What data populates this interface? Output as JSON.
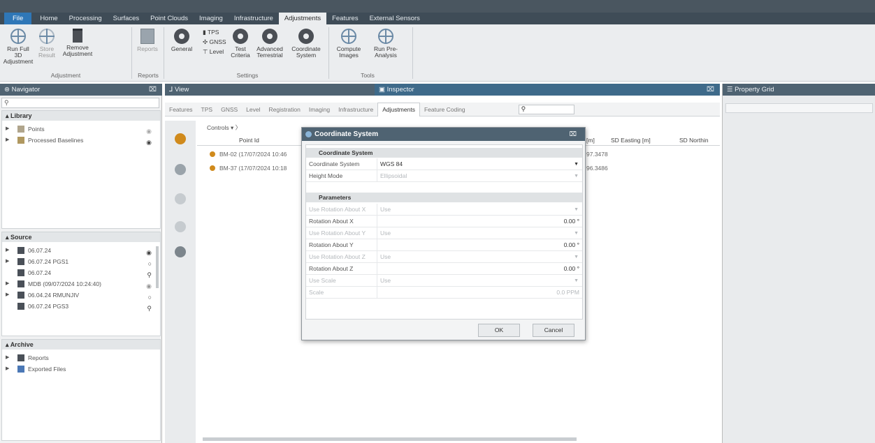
{
  "menu": {
    "items": [
      "File",
      "Home",
      "Processing",
      "Surfaces",
      "Point Clouds",
      "Imaging",
      "Infrastructure",
      "Adjustments",
      "Features",
      "External Sensors"
    ],
    "active": "Adjustments"
  },
  "ribbon": {
    "run_full": "Run Full 3D Adjustment",
    "store_result": "Store Result",
    "remove_adjustment": "Remove Adjustment",
    "reports": "Reports",
    "general": "General",
    "tps": "TPS",
    "gnss": "GNSS",
    "level": "Level",
    "test_criteria": "Test Criteria",
    "advanced_terrestrial": "Advanced Terrestrial",
    "coordinate_system": "Coordinate System",
    "compute_images": "Compute Images",
    "run_pre_analysis": "Run Pre-Analysis",
    "groups": {
      "adjustment": "Adjustment",
      "reports": "Reports",
      "settings": "Settings",
      "tools": "Tools"
    }
  },
  "navigator": {
    "title": "Navigator",
    "search_placeholder": "",
    "library": {
      "title": "Library",
      "items": [
        "Points",
        "Processed Baselines"
      ]
    },
    "source": {
      "title": "Source",
      "items": [
        "06.07.24",
        "06.07.24 PGS1",
        "06.07.24",
        "MDB (09/07/2024 10:24:40)",
        "06.04.24 RMUNJIV",
        "06.07.24 PGS3"
      ]
    },
    "archive": {
      "title": "Archive",
      "items": [
        "Reports",
        "Exported Files"
      ]
    }
  },
  "view": {
    "title": "View"
  },
  "inspector": {
    "title": "Inspector",
    "tabs": [
      "Features",
      "TPS",
      "GNSS",
      "Level",
      "Registration",
      "Imaging",
      "Infrastructure",
      "Adjustments",
      "Feature Coding"
    ],
    "active_tab": "Adjustments",
    "filter_label": "Controls",
    "column_point_id": "Point Id",
    "column_sd_easting": "SD Easting [m]",
    "column_sd_northing": "SD Northin",
    "column_partial": "[m]",
    "rows": [
      {
        "id": "BM-02 (17/07/2024 10:46",
        "val": "97.3478"
      },
      {
        "id": "BM-37 (17/07/2024 10:18",
        "val": "96.3486"
      }
    ]
  },
  "property_grid": {
    "title": "Property Grid"
  },
  "dialog": {
    "title": "Coordinate System",
    "close": "⌧",
    "cat_coord": "Coordinate System",
    "cat_params": "Parameters",
    "coord_system_label": "Coordinate System",
    "coord_system_value": "WGS 84",
    "height_mode_label": "Height Mode",
    "height_mode_value": "Ellipsoidal",
    "use_rot_x_label": "Use Rotation About X",
    "use_rot_x_value": "Use",
    "rot_x_label": "Rotation About X",
    "rot_x_value": "0.00 °",
    "use_rot_y_label": "Use Rotation About Y",
    "use_rot_y_value": "Use",
    "rot_y_label": "Rotation About Y",
    "rot_y_value": "0.00 °",
    "use_rot_z_label": "Use Rotation About Z",
    "use_rot_z_value": "Use",
    "rot_z_label": "Rotation About Z",
    "rot_z_value": "0.00 °",
    "use_scale_label": "Use Scale",
    "use_scale_value": "Use",
    "scale_label": "Scale",
    "scale_value": "0.0 PPM",
    "ok": "OK",
    "cancel": "Cancel"
  }
}
